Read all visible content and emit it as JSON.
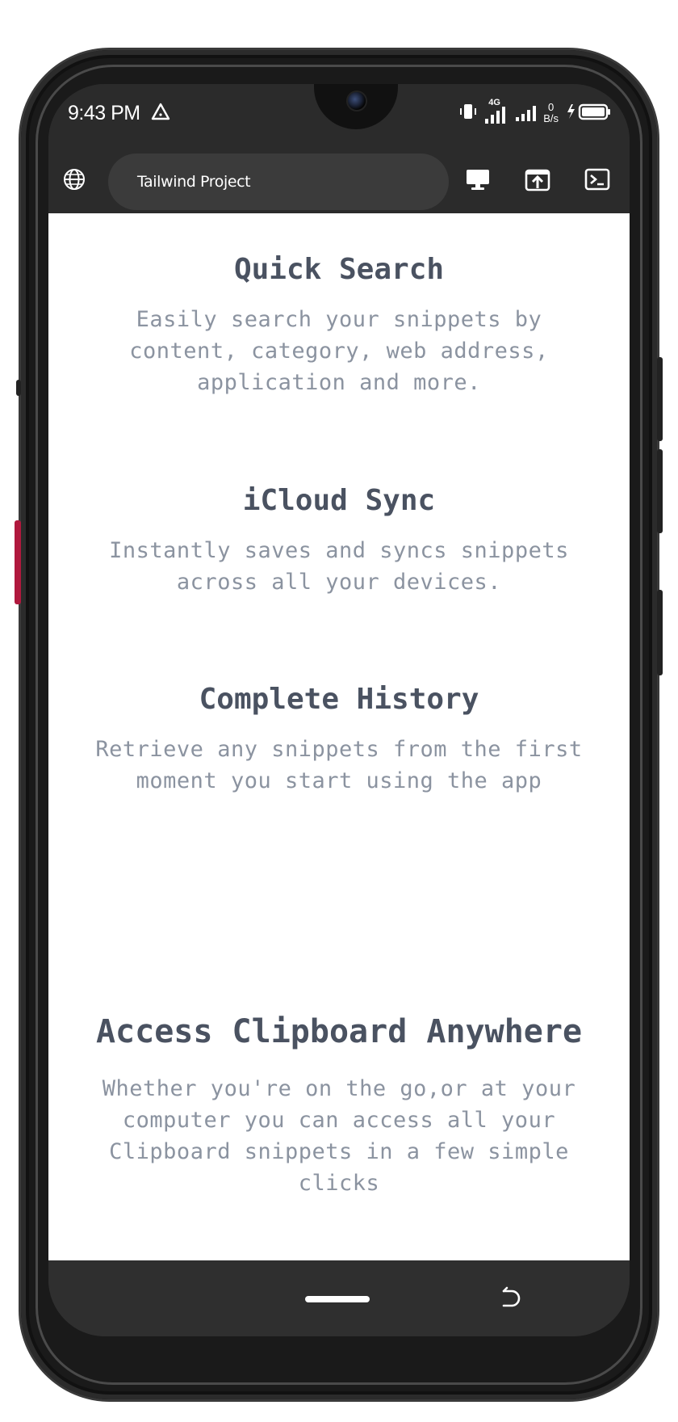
{
  "status_bar": {
    "time": "9:43 PM",
    "network_type": "4G",
    "net_speed_value": "0",
    "net_speed_unit": "B/s"
  },
  "browser": {
    "url_title": "Tailwind Project",
    "icons": [
      "globe-icon",
      "desktop-icon",
      "share-upload-icon",
      "terminal-icon"
    ]
  },
  "features": [
    {
      "title": "Quick Search",
      "description": "Easily search your snippets by content, category, web address, application and more."
    },
    {
      "title": "iCloud Sync",
      "description": "Instantly saves and syncs snippets across all your devices."
    },
    {
      "title": "Complete History",
      "description": "Retrieve any snippets from the first moment you start using the app"
    }
  ],
  "section": {
    "title": "Access Clipboard Anywhere",
    "description": "Whether you're on the go,or at your computer you can access all your Clipboard snippets in a few simple clicks"
  },
  "colors": {
    "heading": "#4a5261",
    "body_text": "#8b93a0",
    "chrome_dark": "#2b2b2b",
    "accent_button": "#b0183d"
  }
}
